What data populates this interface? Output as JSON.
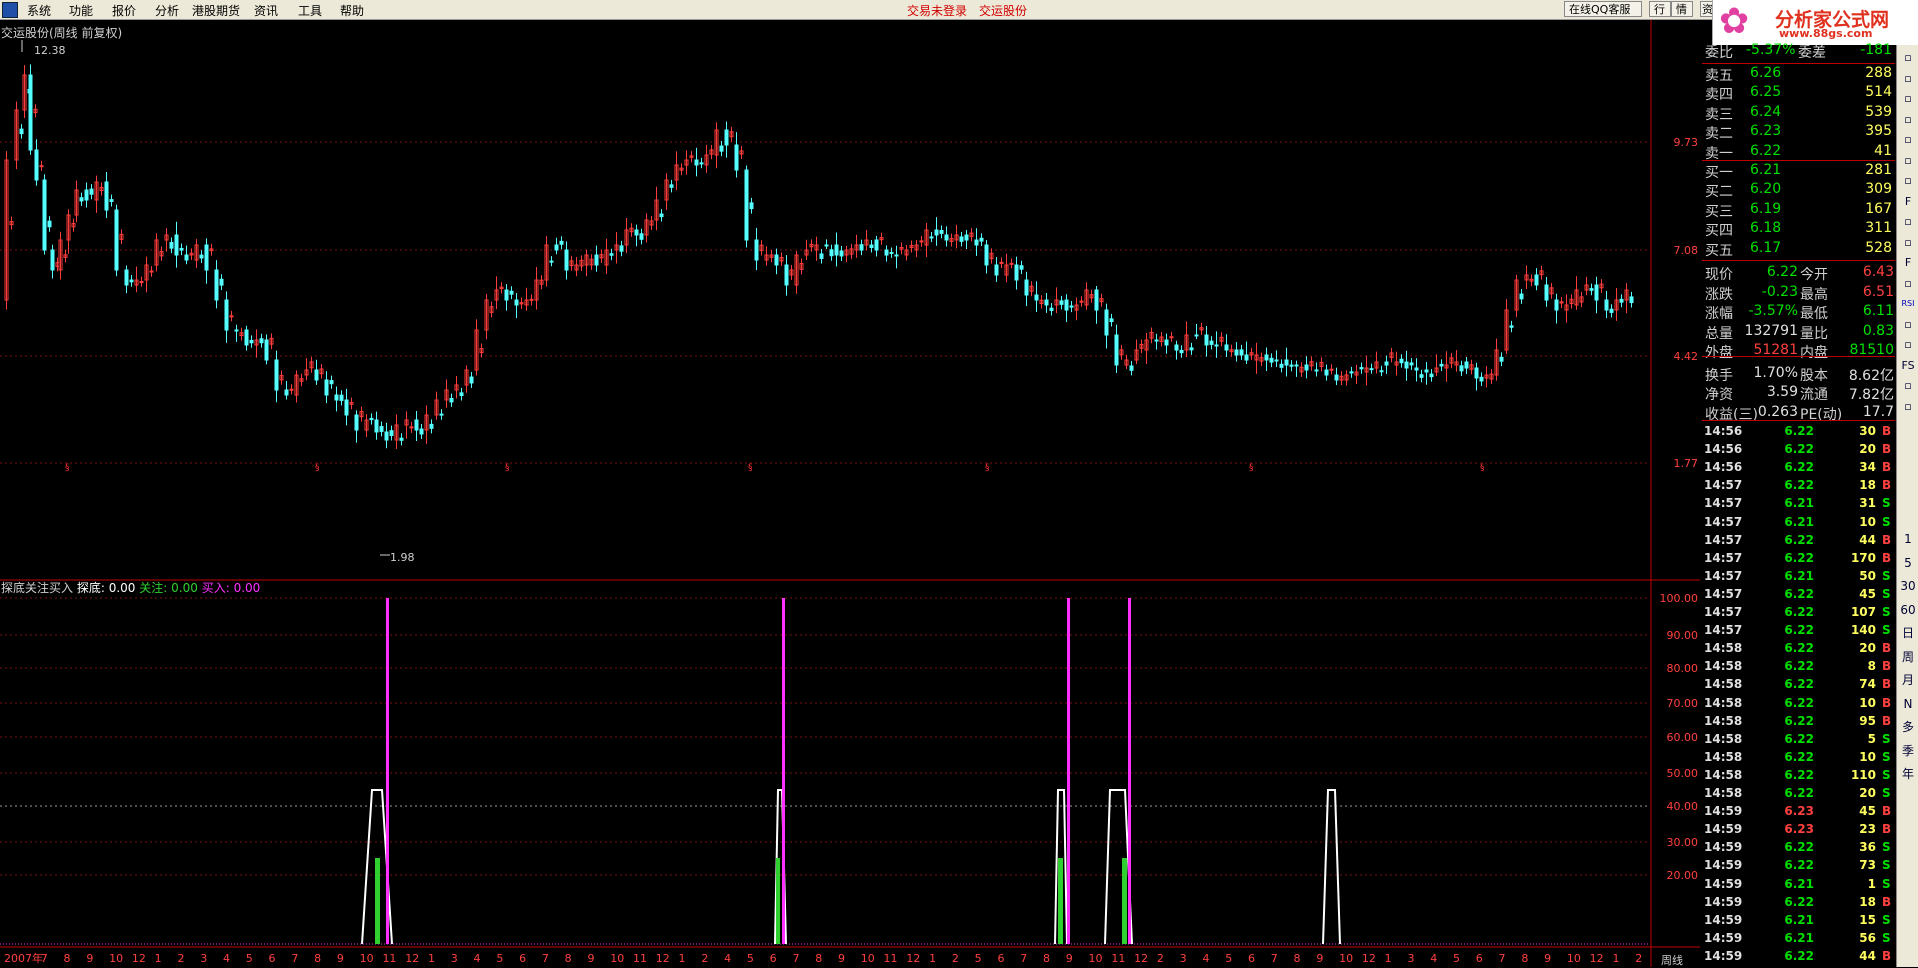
{
  "menu": {
    "items": [
      "系统",
      "功能",
      "报价",
      "分析",
      "港股期货",
      "资讯",
      "工具",
      "帮助"
    ],
    "status_left": "交易未登录",
    "status_right": "交运股份",
    "qq_button": "在线QQ客服",
    "btn_hang": "行",
    "btn_qing": "情",
    "btn_zi": "资"
  },
  "logo": {
    "title": "分析家公式网",
    "url": "www.88gs.com"
  },
  "main_chart": {
    "title": "交运股份(周线 前复权)",
    "high_label": "12.38",
    "low_label": "1.98",
    "y_ticks": [
      "9.73",
      "7.08",
      "4.42",
      "1.77"
    ],
    "x_axis_label": "周线",
    "x_ticks": [
      "2007年",
      "7",
      "8",
      "9",
      "10",
      "12",
      "1",
      "2",
      "3",
      "4",
      "5",
      "6",
      "7",
      "8",
      "9",
      "10",
      "11",
      "12",
      "1",
      "3",
      "4",
      "5",
      "6",
      "7",
      "8",
      "9",
      "10",
      "11",
      "12",
      "1",
      "2",
      "4",
      "5",
      "6",
      "7",
      "8",
      "9",
      "10",
      "11",
      "12",
      "1",
      "2",
      "5",
      "6",
      "7",
      "8",
      "9",
      "10",
      "11",
      "12",
      "2",
      "3",
      "4",
      "5",
      "6",
      "7",
      "8",
      "9",
      "10",
      "12",
      "1",
      "3",
      "4",
      "5",
      "6",
      "7",
      "8",
      "9",
      "10",
      "12",
      "1",
      "2"
    ]
  },
  "indicator": {
    "name": "探底关注买入",
    "tandi_label": "探底:",
    "tandi_value": "0.00",
    "guanzhu_label": "关注:",
    "guanzhu_value": "0.00",
    "mairu_label": "买入:",
    "mairu_value": "0.00",
    "y_ticks": [
      "100.00",
      "90.00",
      "80.00",
      "70.00",
      "60.00",
      "50.00",
      "40.00",
      "30.00",
      "20.00"
    ]
  },
  "quote": {
    "weibi": {
      "label": "委比",
      "value": "-5.37%",
      "label2": "委差",
      "value2": "-181"
    },
    "asks": [
      {
        "label": "卖五",
        "price": "6.26",
        "vol": "288"
      },
      {
        "label": "卖四",
        "price": "6.25",
        "vol": "514"
      },
      {
        "label": "卖三",
        "price": "6.24",
        "vol": "539"
      },
      {
        "label": "卖二",
        "price": "6.23",
        "vol": "395"
      },
      {
        "label": "卖一",
        "price": "6.22",
        "vol": "41"
      }
    ],
    "bids": [
      {
        "label": "买一",
        "price": "6.21",
        "vol": "281"
      },
      {
        "label": "买二",
        "price": "6.20",
        "vol": "309"
      },
      {
        "label": "买三",
        "price": "6.19",
        "vol": "167"
      },
      {
        "label": "买四",
        "price": "6.18",
        "vol": "311"
      },
      {
        "label": "买五",
        "price": "6.17",
        "vol": "528"
      }
    ],
    "stats": [
      {
        "l1": "现价",
        "v1": "6.22",
        "c1": "#00e000",
        "l2": "今开",
        "v2": "6.43",
        "c2": "#ff4040"
      },
      {
        "l1": "涨跌",
        "v1": "-0.23",
        "c1": "#00e000",
        "l2": "最高",
        "v2": "6.51",
        "c2": "#ff4040"
      },
      {
        "l1": "涨幅",
        "v1": "-3.57%",
        "c1": "#00e000",
        "l2": "最低",
        "v2": "6.11",
        "c2": "#00e000"
      },
      {
        "l1": "总量",
        "v1": "132791",
        "c1": "#e0e0e0",
        "l2": "量比",
        "v2": "0.83",
        "c2": "#00e000"
      },
      {
        "l1": "外盘",
        "v1": "51281",
        "c1": "#ff4040",
        "l2": "内盘",
        "v2": "81510",
        "c2": "#00e000"
      },
      {
        "l1": "换手",
        "v1": "1.70%",
        "c1": "#e0e0e0",
        "l2": "股本",
        "v2": "8.62亿",
        "c2": "#e0e0e0"
      },
      {
        "l1": "净资",
        "v1": "3.59",
        "c1": "#e0e0e0",
        "l2": "流通",
        "v2": "7.82亿",
        "c2": "#e0e0e0"
      },
      {
        "l1": "收益(三)",
        "v1": "0.263",
        "c1": "#e0e0e0",
        "l2": "PE(动)",
        "v2": "17.7",
        "c2": "#e0e0e0"
      }
    ],
    "ticks": [
      {
        "t": "14:56",
        "p": "6.22",
        "v": "30",
        "s": "B"
      },
      {
        "t": "14:56",
        "p": "6.22",
        "v": "20",
        "s": "B"
      },
      {
        "t": "14:56",
        "p": "6.22",
        "v": "34",
        "s": "B"
      },
      {
        "t": "14:57",
        "p": "6.22",
        "v": "18",
        "s": "B"
      },
      {
        "t": "14:57",
        "p": "6.21",
        "v": "31",
        "s": "S"
      },
      {
        "t": "14:57",
        "p": "6.21",
        "v": "10",
        "s": "S"
      },
      {
        "t": "14:57",
        "p": "6.22",
        "v": "44",
        "s": "B"
      },
      {
        "t": "14:57",
        "p": "6.22",
        "v": "170",
        "s": "B"
      },
      {
        "t": "14:57",
        "p": "6.21",
        "v": "50",
        "s": "S"
      },
      {
        "t": "14:57",
        "p": "6.22",
        "v": "45",
        "s": "S"
      },
      {
        "t": "14:57",
        "p": "6.22",
        "v": "107",
        "s": "S"
      },
      {
        "t": "14:57",
        "p": "6.22",
        "v": "140",
        "s": "S"
      },
      {
        "t": "14:58",
        "p": "6.22",
        "v": "20",
        "s": "B"
      },
      {
        "t": "14:58",
        "p": "6.22",
        "v": "8",
        "s": "B"
      },
      {
        "t": "14:58",
        "p": "6.22",
        "v": "74",
        "s": "B"
      },
      {
        "t": "14:58",
        "p": "6.22",
        "v": "10",
        "s": "B"
      },
      {
        "t": "14:58",
        "p": "6.22",
        "v": "95",
        "s": "B"
      },
      {
        "t": "14:58",
        "p": "6.22",
        "v": "5",
        "s": "S"
      },
      {
        "t": "14:58",
        "p": "6.22",
        "v": "10",
        "s": "S"
      },
      {
        "t": "14:58",
        "p": "6.22",
        "v": "110",
        "s": "S"
      },
      {
        "t": "14:58",
        "p": "6.22",
        "v": "20",
        "s": "S"
      },
      {
        "t": "14:59",
        "p": "6.23",
        "v": "45",
        "s": "B"
      },
      {
        "t": "14:59",
        "p": "6.23",
        "v": "23",
        "s": "B"
      },
      {
        "t": "14:59",
        "p": "6.22",
        "v": "36",
        "s": "S"
      },
      {
        "t": "14:59",
        "p": "6.22",
        "v": "73",
        "s": "S"
      },
      {
        "t": "14:59",
        "p": "6.21",
        "v": "1",
        "s": "S"
      },
      {
        "t": "14:59",
        "p": "6.22",
        "v": "18",
        "s": "B"
      },
      {
        "t": "14:59",
        "p": "6.21",
        "v": "15",
        "s": "S"
      },
      {
        "t": "14:59",
        "p": "6.21",
        "v": "56",
        "s": "S"
      },
      {
        "t": "14:59",
        "p": "6.22",
        "v": "44",
        "s": "B"
      }
    ]
  },
  "toolbar": [
    "1",
    "5",
    "30",
    "60",
    "日",
    "周",
    "月",
    "N",
    "多",
    "季",
    "年"
  ],
  "colors": {
    "up": "#ff3c3c",
    "down": "#54ffff",
    "grid": "#7a1010",
    "buy": "#ff30ff",
    "watch": "#30d030",
    "bottom": "#ffffff"
  }
}
